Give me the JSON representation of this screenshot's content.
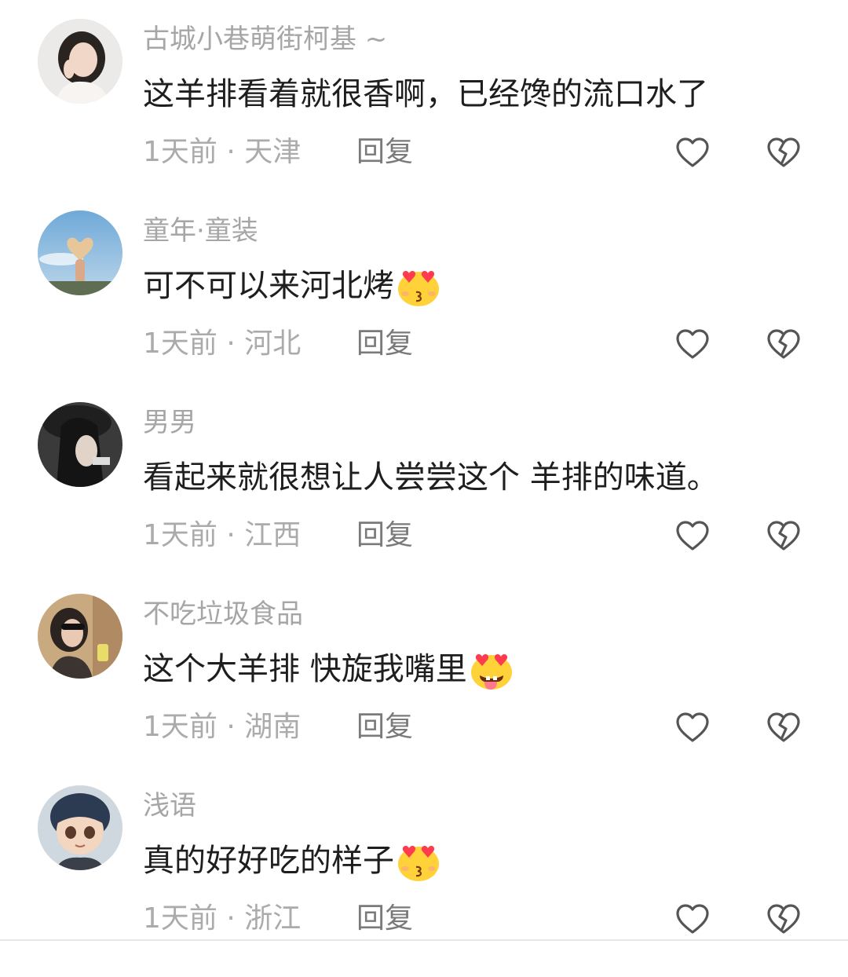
{
  "comments": [
    {
      "username": "古城小巷萌街柯基 ~",
      "text": "这羊排看着就很香啊，已经馋的流口水了",
      "emoji": "",
      "time": "1天前",
      "location": "天津",
      "reply": "回复"
    },
    {
      "username": "童年·童装",
      "text": "可不可以来河北烤",
      "emoji": "heart-eyes-kiss-emoji",
      "time": "1天前",
      "location": "河北",
      "reply": "回复"
    },
    {
      "username": "男男",
      "text": "看起来就很想让人尝尝这个 羊排的味道。",
      "emoji": "",
      "time": "1天前",
      "location": "江西",
      "reply": "回复"
    },
    {
      "username": "不吃垃圾食品",
      "text": "这个大羊排 快旋我嘴里",
      "emoji": "heart-eyes-tongue-emoji",
      "time": "1天前",
      "location": "湖南",
      "reply": "回复"
    },
    {
      "username": "浅语",
      "text": "真的好好吃的样子",
      "emoji": "heart-eyes-kiss-emoji",
      "time": "1天前",
      "location": "浙江",
      "reply": "回复"
    }
  ],
  "meta_separator": " · ",
  "icons": {
    "like": "heart-outline-icon",
    "dislike": "broken-heart-icon"
  },
  "colors": {
    "username": "#a6a6a6",
    "text": "#1e1e1e",
    "meta": "#ababab",
    "reply": "#7a7a7a",
    "icon": "#555555"
  }
}
